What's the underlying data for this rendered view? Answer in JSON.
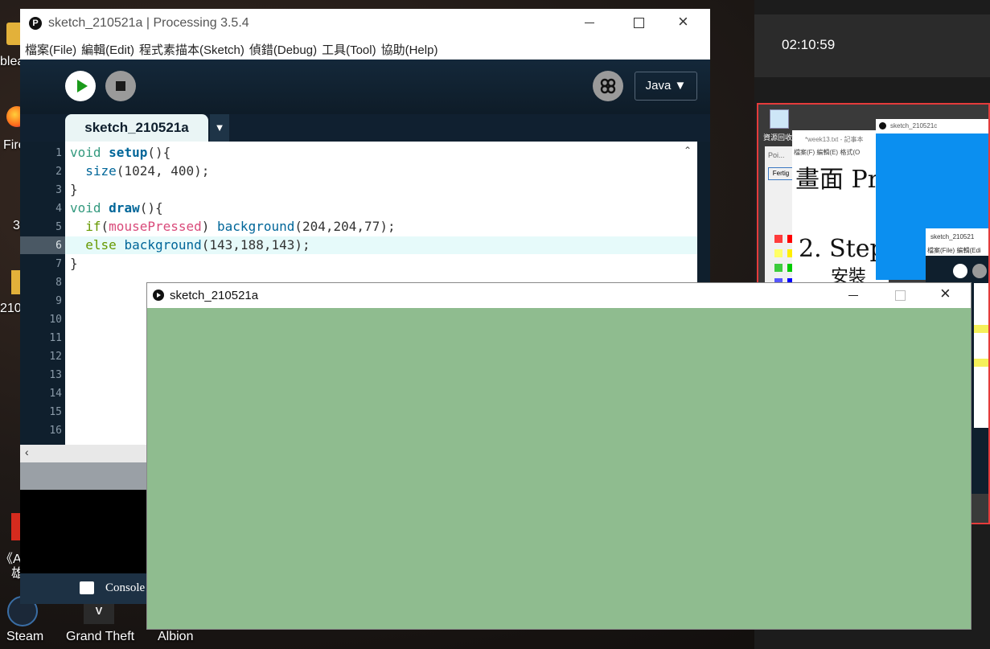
{
  "desktop": {
    "icons": [
      {
        "label": "blea",
        "name": "desktop-icon-blea"
      },
      {
        "label": "Fire",
        "name": "desktop-icon-firefox"
      },
      {
        "label": "3",
        "name": "desktop-icon-3"
      },
      {
        "label": "210",
        "name": "desktop-icon-210"
      },
      {
        "label": "《Ap",
        "name": "desktop-icon-ap"
      },
      {
        "label": "雄",
        "name": "desktop-icon-xiong"
      }
    ],
    "taskbar_labels": {
      "steam": "Steam",
      "gta": "Grand Theft",
      "albion": "Albion"
    }
  },
  "clock": "02:10:59",
  "ide": {
    "title": "sketch_210521a | Processing 3.5.4",
    "menu": [
      "檔案(File)",
      "編輯(Edit)",
      "程式素描本(Sketch)",
      "偵錯(Debug)",
      "工具(Tool)",
      "協助(Help)"
    ],
    "mode": "Java ▼",
    "tab": "sketch_210521a",
    "tab_arrow": "▼",
    "console_label": "Console",
    "line_numbers": [
      "1",
      "2",
      "3",
      "4",
      "5",
      "6",
      "7",
      "8",
      "9",
      "10",
      "11",
      "12",
      "13",
      "14",
      "15",
      "16"
    ],
    "code": {
      "l1a": "void",
      "l1b": "setup",
      "l1c": "(){",
      "l2a": "size",
      "l2b": "(1024, 400);",
      "l3": "}",
      "l4a": "void",
      "l4b": "draw",
      "l4c": "(){",
      "l5a": "if",
      "l5b": "(",
      "l5c": "mousePressed",
      "l5d": ") ",
      "l5e": "background",
      "l5f": "(204,204,77);",
      "l6a": "else",
      "l6b": " ",
      "l6c": "background",
      "l6d": "(143,188,143);",
      "l7": "}"
    }
  },
  "sketch_window": {
    "title": "sketch_210521a",
    "canvas_color": "#8fbc8f"
  },
  "thumbnail": {
    "recycle_label": "資源回收",
    "notepad_title": "*week13.txt - 記事本",
    "notepad_menu": "檔案(F)  編輯(E)  格式(O",
    "notepad_text1": "畫面 Pr",
    "notepad_text2": "2. Step",
    "notepad_text3": "安裝",
    "paint_label": "Poi...",
    "paint_button": "Fertig",
    "sketch_c_title": "sketch_210521c",
    "sketch_b_title": "sketch_210521",
    "sketch_b_menu": "檔案(File)  編輯(Edi"
  },
  "colors": {
    "sketch_bg": "#8fbc8f",
    "ide_bg": "#0f1f2d",
    "active_line": "#e6fafa"
  }
}
